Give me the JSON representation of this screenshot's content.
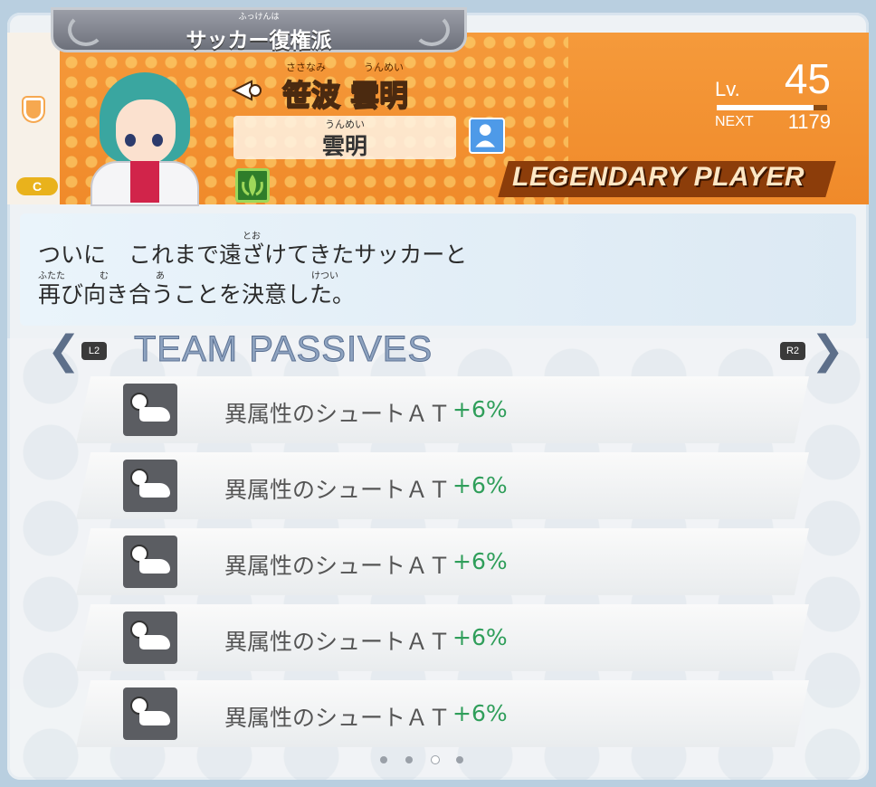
{
  "header": {
    "faction": "サッカー復権派",
    "faction_ruby": "ふっけんは",
    "name": "笹波 雲明",
    "name_ruby_family": "ささなみ",
    "name_ruby_given": "うんめい",
    "nickname": "雲明",
    "nickname_ruby": "うんめい",
    "level_label": "Lv.",
    "level": "45",
    "level_progress": 0.88,
    "next_label": "NEXT",
    "next_value": "1179",
    "rarity": "LEGENDARY PLAYER",
    "wing_badge": "C"
  },
  "quote": {
    "line1": "ついに　これまで遠ざけてきたサッカーと",
    "line2": "再び向き合うことを決意した。",
    "ruby_tou": "とお",
    "ruby_futata": "ふたた",
    "ruby_mu": "む",
    "ruby_a": "あ",
    "ruby_ketsui": "けつい"
  },
  "passives": {
    "title": "TEAM PASSIVES",
    "prev_button": "L2",
    "next_button": "R2",
    "items": [
      {
        "text": "異属性のシュートＡＴ",
        "value": "+6%"
      },
      {
        "text": "異属性のシュートＡＴ",
        "value": "+6%"
      },
      {
        "text": "異属性のシュートＡＴ",
        "value": "+6%"
      },
      {
        "text": "異属性のシュートＡＴ",
        "value": "+6%"
      },
      {
        "text": "異属性のシュートＡＴ",
        "value": "+6%"
      }
    ]
  },
  "pagination": {
    "total": 4,
    "active": 3
  },
  "colors": {
    "accent": "#f08a2a",
    "positive": "#2f9e5a"
  }
}
